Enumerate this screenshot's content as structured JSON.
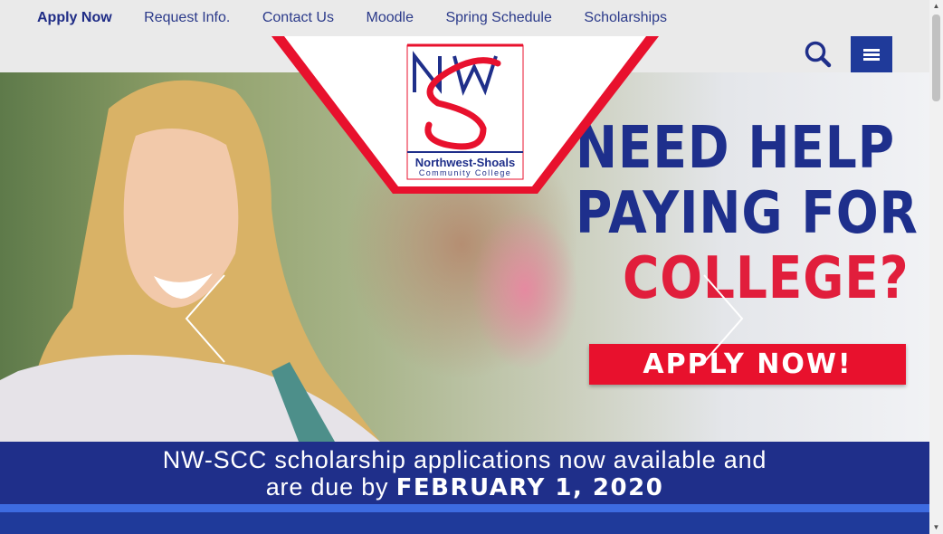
{
  "nav": {
    "links": [
      "Apply Now",
      "Request Info.",
      "Contact Us",
      "Moodle",
      "Spring Schedule",
      "Scholarships"
    ]
  },
  "header": {
    "search_icon": "search-icon",
    "menu_icon": "hamburger-menu-icon"
  },
  "logo": {
    "mark": "NWS",
    "name": "Northwest-Shoals",
    "subtitle": "Community College"
  },
  "slide": {
    "headline_1": "NEED HELP",
    "headline_2": "PAYING FOR",
    "headline_3": "COLLEGE?",
    "cta": "APPLY NOW!",
    "prev_icon": "chevron-left-icon",
    "next_icon": "chevron-right-icon"
  },
  "banner": {
    "line1": "NW-SCC scholarship applications now available and",
    "line2_prefix": "are due by",
    "due_date": "FEBRUARY 1, 2020"
  },
  "colors": {
    "brand_blue": "#1f2f8a",
    "brand_red": "#e8112d",
    "stripe_blue": "#3d6be0"
  }
}
